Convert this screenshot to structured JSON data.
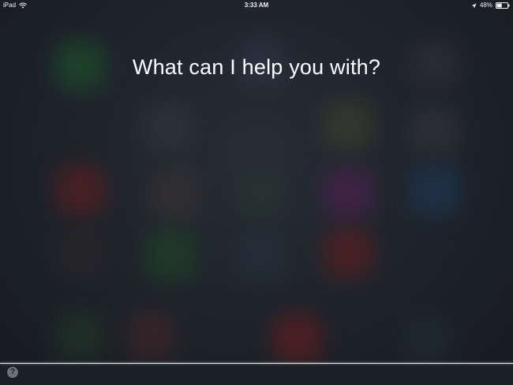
{
  "status_bar": {
    "device": "iPad",
    "time": "3:33 AM",
    "battery_percent": "48%",
    "battery_level": 0.48,
    "icons": [
      "wifi-icon",
      "location-arrow-icon",
      "battery-icon"
    ]
  },
  "siri": {
    "prompt": "What can I help you with?",
    "help_glyph": "?"
  },
  "colors": {
    "background": "#1e242b",
    "text": "#ffffff",
    "waveform": "#e8eef2"
  }
}
